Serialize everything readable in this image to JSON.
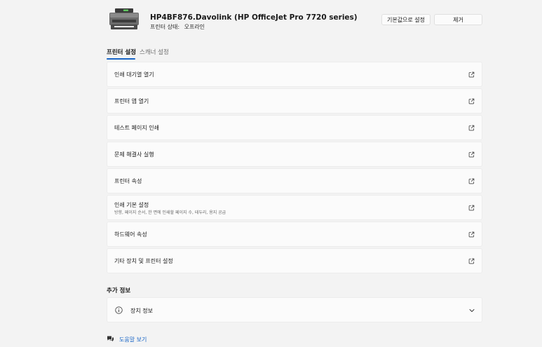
{
  "header": {
    "printer_name": "HP4BF876.Davolink (HP OfficeJet Pro 7720 series)",
    "status_label": "프린터 상태:",
    "status_value": "오프라인",
    "set_default_label": "기본값으로 설정",
    "remove_label": "제거",
    "printer_icon": "printer-icon"
  },
  "tabs": [
    {
      "label": "프린터 설정",
      "active": true
    },
    {
      "label": "스캐너 설정",
      "active": false
    }
  ],
  "settings_items": [
    {
      "label": "인쇄 대기열 열기",
      "icon": "external-link-icon"
    },
    {
      "label": "프린터 앱 열기",
      "icon": "external-link-icon"
    },
    {
      "label": "테스트 페이지 인쇄",
      "icon": "external-link-icon"
    },
    {
      "label": "문제 해결사 실행",
      "icon": "external-link-icon"
    },
    {
      "label": "프린터 속성",
      "icon": "external-link-icon"
    },
    {
      "label": "인쇄 기본 설정",
      "sublabel": "방향, 페이지 순서, 한 면에 인쇄할 페이지 수, 테두리, 용지 공급",
      "icon": "external-link-icon"
    },
    {
      "label": "하드웨어 속성",
      "icon": "external-link-icon"
    },
    {
      "label": "기타 장치 및 프린터 설정",
      "icon": "external-link-icon"
    }
  ],
  "additional_info": {
    "title": "추가 정보",
    "device_info_label": "장치 정보",
    "icon": "info-icon",
    "expand_icon": "chevron-down-icon"
  },
  "help": {
    "label": "도움말 보기",
    "icon": "help-chat-icon"
  },
  "colors": {
    "accent": "#1a66c7",
    "background": "#f3f3f3",
    "card": "#fbfbfb"
  }
}
